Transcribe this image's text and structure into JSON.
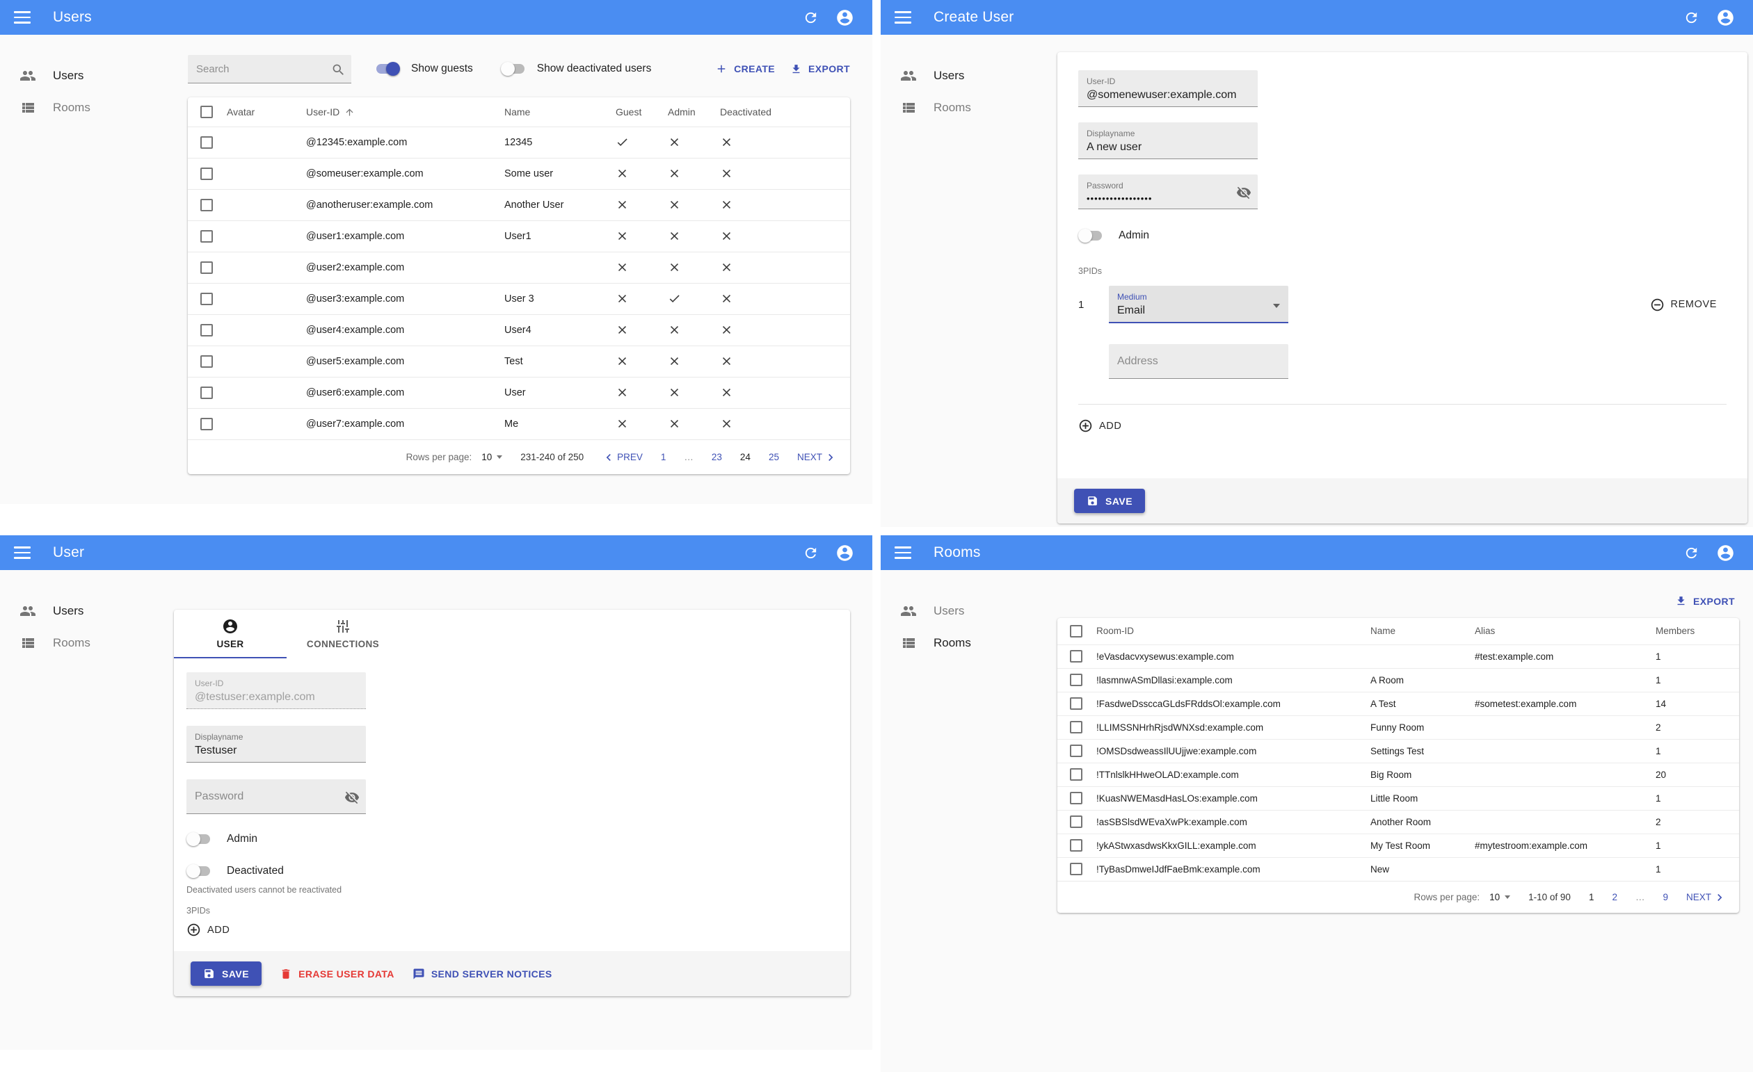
{
  "colors": {
    "appbar": "#4a8df2",
    "accent": "#3f51b5",
    "danger": "#e53935",
    "toggle_on": "#3f51b5"
  },
  "sidebar": {
    "users": "Users",
    "rooms": "Rooms"
  },
  "panels": {
    "users_list": {
      "title": "Users",
      "toolbar": {
        "search_placeholder": "Search",
        "show_guests": "Show guests",
        "show_deactivated": "Show deactivated users",
        "create": "CREATE",
        "export": "EXPORT"
      },
      "table": {
        "headers": {
          "avatar": "Avatar",
          "user_id": "User-ID",
          "name": "Name",
          "guest": "Guest",
          "admin": "Admin",
          "deactivated": "Deactivated"
        },
        "rows": [
          {
            "user_id": "@12345:example.com",
            "name": "12345",
            "guest": true,
            "admin": false,
            "deactivated": false
          },
          {
            "user_id": "@someuser:example.com",
            "name": "Some user",
            "guest": false,
            "admin": false,
            "deactivated": false
          },
          {
            "user_id": "@anotheruser:example.com",
            "name": "Another User",
            "guest": false,
            "admin": false,
            "deactivated": false
          },
          {
            "user_id": "@user1:example.com",
            "name": "User1",
            "guest": false,
            "admin": false,
            "deactivated": false
          },
          {
            "user_id": "@user2:example.com",
            "name": "",
            "guest": false,
            "admin": false,
            "deactivated": false
          },
          {
            "user_id": "@user3:example.com",
            "name": "User 3",
            "guest": false,
            "admin": true,
            "deactivated": false
          },
          {
            "user_id": "@user4:example.com",
            "name": "User4",
            "guest": false,
            "admin": false,
            "deactivated": false
          },
          {
            "user_id": "@user5:example.com",
            "name": "Test",
            "guest": false,
            "admin": false,
            "deactivated": false
          },
          {
            "user_id": "@user6:example.com",
            "name": "User",
            "guest": false,
            "admin": false,
            "deactivated": false
          },
          {
            "user_id": "@user7:example.com",
            "name": "Me",
            "guest": false,
            "admin": false,
            "deactivated": false
          }
        ]
      },
      "pagination": {
        "rows_per_page_label": "Rows per page:",
        "rows_per_page": "10",
        "range": "231-240 of 250",
        "prev": "PREV",
        "next": "NEXT",
        "pages": [
          "1",
          "…",
          "23",
          "24",
          "25"
        ],
        "current_page": "24"
      }
    },
    "create_user": {
      "title": "Create User",
      "form": {
        "user_id_label": "User-ID",
        "user_id_value": "@somenewuser:example.com",
        "displayname_label": "Displayname",
        "displayname_value": "A new user",
        "password_label": "Password",
        "password_value": "•••••••••••••••••",
        "admin_label": "Admin",
        "threepids_label": "3PIDs",
        "pid_index": "1",
        "medium_label": "Medium",
        "medium_value": "Email",
        "remove": "REMOVE",
        "address_placeholder": "Address",
        "add": "ADD",
        "save": "SAVE"
      }
    },
    "user_edit": {
      "title": "User",
      "tabs": {
        "user": "USER",
        "connections": "CONNECTIONS"
      },
      "form": {
        "user_id_label": "User-ID",
        "user_id_value": "@testuser:example.com",
        "displayname_label": "Displayname",
        "displayname_value": "Testuser",
        "password_placeholder": "Password",
        "admin_label": "Admin",
        "deactivated_label": "Deactivated",
        "deactivated_help": "Deactivated users cannot be reactivated",
        "threepids_label": "3PIDs",
        "add": "ADD",
        "save": "SAVE",
        "erase": "ERASE USER DATA",
        "notices": "SEND SERVER NOTICES"
      }
    },
    "rooms_list": {
      "title": "Rooms",
      "export": "EXPORT",
      "table": {
        "headers": {
          "room_id": "Room-ID",
          "name": "Name",
          "alias": "Alias",
          "members": "Members"
        },
        "rows": [
          {
            "room_id": "!eVasdacvxysewus:example.com",
            "name": "",
            "alias": "#test:example.com",
            "members": "1"
          },
          {
            "room_id": "!lasmnwASmDllasi:example.com",
            "name": "A Room",
            "alias": "",
            "members": "1"
          },
          {
            "room_id": "!FasdweDssccaGLdsFRddsOl:example.com",
            "name": "A Test",
            "alias": "#sometest:example.com",
            "members": "14"
          },
          {
            "room_id": "!LLIMSSNHrhRjsdWNXsd:example.com",
            "name": "Funny Room",
            "alias": "",
            "members": "2"
          },
          {
            "room_id": "!OMSDsdweassIlUUjjwe:example.com",
            "name": "Settings Test",
            "alias": "",
            "members": "1"
          },
          {
            "room_id": "!TTnlslkHHweOLAD:example.com",
            "name": "Big Room",
            "alias": "",
            "members": "20"
          },
          {
            "room_id": "!KuasNWEMasdHasLOs:example.com",
            "name": "Little Room",
            "alias": "",
            "members": "1"
          },
          {
            "room_id": "!asSBSlsdWEvaXwPk:example.com",
            "name": "Another Room",
            "alias": "",
            "members": "2"
          },
          {
            "room_id": "!ykAStwxasdwsKkxGILL:example.com",
            "name": "My Test Room",
            "alias": "#mytestroom:example.com",
            "members": "1"
          },
          {
            "room_id": "!TyBasDmweIJdfFaeBmk:example.com",
            "name": "New",
            "alias": "",
            "members": "1"
          }
        ]
      },
      "pagination": {
        "rows_per_page_label": "Rows per page:",
        "rows_per_page": "10",
        "range": "1-10 of 90",
        "pages": [
          "1",
          "2",
          "…",
          "9"
        ],
        "current_page": "1",
        "next": "NEXT"
      }
    }
  }
}
